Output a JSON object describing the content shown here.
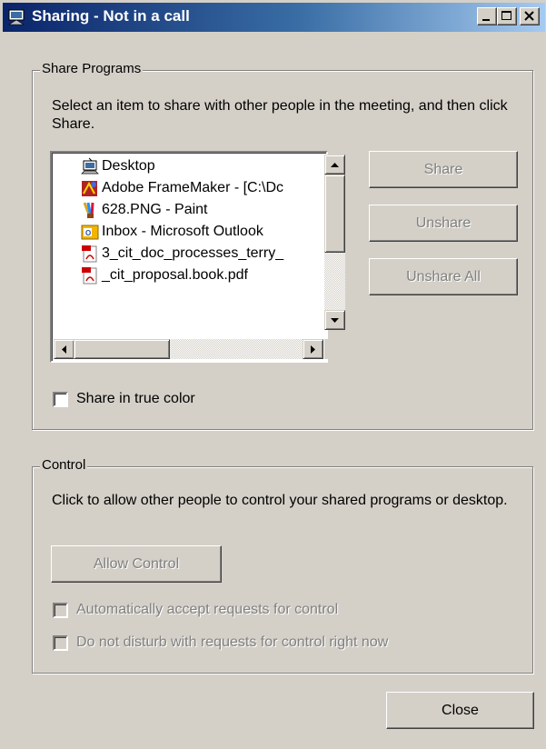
{
  "window": {
    "title": "Sharing - Not in a call",
    "controls": [
      "minimize-icon",
      "maximize-icon",
      "close-icon"
    ]
  },
  "share_programs": {
    "group_label": "Share Programs",
    "description": "Select an item to share with other people in the meeting, and then click Share.",
    "items": [
      {
        "label": "Desktop",
        "icon": "desktop-icon"
      },
      {
        "label": "Adobe FrameMaker - [C:\\Dc",
        "icon": "framemaker-icon"
      },
      {
        "label": "628.PNG - Paint",
        "icon": "paint-icon"
      },
      {
        "label": "Inbox - Microsoft Outlook",
        "icon": "outlook-icon"
      },
      {
        "label": "3_cit_doc_processes_terry_",
        "icon": "pdf-icon"
      },
      {
        "label": "_cit_proposal.book.pdf",
        "icon": "pdf-icon"
      }
    ],
    "buttons": {
      "share": "Share",
      "unshare": "Unshare",
      "unshare_all": "Unshare All"
    },
    "true_color_label": "Share in true color"
  },
  "control": {
    "group_label": "Control",
    "description": "Click to allow other people to control your shared programs or desktop.",
    "allow_button": "Allow Control",
    "auto_accept_label": "Automatically accept requests for control",
    "do_not_disturb_label": "Do not disturb with requests for control right now"
  },
  "footer": {
    "close_button": "Close"
  },
  "colors": {
    "face": "#d4d0c8",
    "title_start": "#0a246a",
    "title_end": "#a6caf0",
    "disabled_text": "#808080"
  }
}
